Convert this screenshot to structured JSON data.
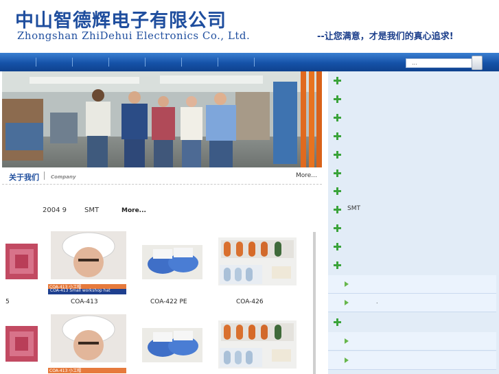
{
  "header": {
    "company_cn": "中山智德辉电子有限公司",
    "company_en": "Zhongshan ZhiDehui Electronics Co., Ltd.",
    "slogan": "--让您满意，才是我们的真心追求!"
  },
  "search": {
    "value": "..."
  },
  "about": {
    "title": "关于我们",
    "subtitle": "Company",
    "more": "More..."
  },
  "news": {
    "year": "2004 9",
    "tag": "SMT",
    "more": "More..."
  },
  "products": {
    "row1": [
      {
        "caption": "5"
      },
      {
        "caption": "COA-413",
        "tag": "COA-413 小工帽",
        "tag_en": "COA-413 Small workshop hat"
      },
      {
        "caption": "COA-422 PE"
      },
      {
        "caption": "COA-426"
      }
    ],
    "row2": [
      {
        "caption": ""
      },
      {
        "caption": "",
        "tag": "COA-413 小工帽"
      },
      {
        "caption": ""
      },
      {
        "caption": ""
      }
    ]
  },
  "categories": [
    {
      "label": ""
    },
    {
      "label": ""
    },
    {
      "label": ""
    },
    {
      "label": ""
    },
    {
      "label": ""
    },
    {
      "label": ""
    },
    {
      "label": ""
    },
    {
      "label": "SMT"
    },
    {
      "label": ""
    },
    {
      "label": ""
    },
    {
      "label": ""
    }
  ],
  "subitems_a": [
    {
      "label": ""
    },
    {
      "label": "."
    }
  ],
  "category_extra": {
    "label": ""
  },
  "subitems_b": [
    {
      "label": ""
    },
    {
      "label": ""
    }
  ],
  "colors": {
    "nav_blue": "#1552a8",
    "title_blue": "#1f4e9e",
    "panel_bg": "#e2ecf7",
    "plus_green": "#3aa33a"
  }
}
